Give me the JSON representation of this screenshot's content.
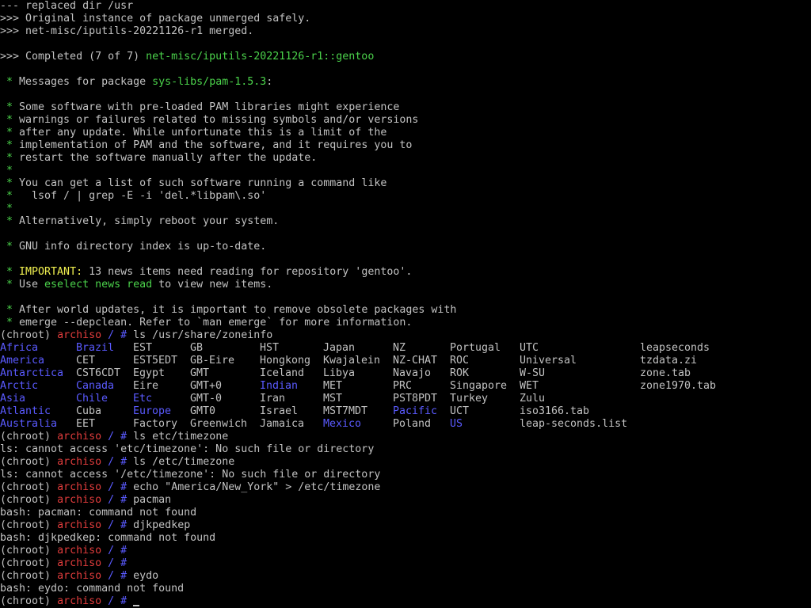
{
  "terminal": {
    "colors": {
      "background": "#000000",
      "text": "#c2c2c2",
      "green": "#4bd24b",
      "yellow": "#f0f050",
      "red": "#e03c3c",
      "blue": "#5a5aff"
    },
    "prompt": {
      "chroot": "(chroot) ",
      "host": "archiso",
      "sep": " / ",
      "hash": "# "
    },
    "emerge": {
      "replaced": "--- replaced dir /usr",
      "unmerged": ">>> Original instance of package unmerged safely.",
      "merged": ">>> net-misc/iputils-20221126-r1 merged.",
      "completed_prefix": ">>> Completed (7 of 7) ",
      "completed_pkg": "net-misc/iputils-20221126-r1::gentoo"
    },
    "messages": {
      "header_prefix": " Messages for package ",
      "header_pkg": "sys-libs/pam-1.5.3",
      "header_suffix": ":",
      "star": " *",
      "l1": " Some software with pre-loaded PAM libraries might experience",
      "l2": " warnings or failures related to missing symbols and/or versions",
      "l3": " after any update. While unfortunate this is a limit of the",
      "l4": " implementation of PAM and the software, and it requires you to",
      "l5": " restart the software manually after the update.",
      "l6": " You can get a list of such software running a command like",
      "l7": "   lsof / | grep -E -i 'del.*libpam\\.so'",
      "l8": " Alternatively, simply reboot your system.",
      "l9": " GNU info directory index is up-to-date.",
      "important_label": " IMPORTANT:",
      "important_text": " 13 news items need reading for repository 'gentoo'.",
      "use_prefix": " Use ",
      "use_cmd": "eselect news read",
      "use_suffix": " to view new items.",
      "l10": " After world updates, it is important to remove obsolete packages with",
      "l11": " emerge --depclean. Refer to `man emerge` for more information."
    },
    "commands": {
      "ls_zoneinfo": "ls /usr/share/zoneinfo",
      "ls_etc": "ls etc/timezone",
      "ls_etc_err": "ls: cannot access 'etc/timezone': No such file or directory",
      "ls_abs": "ls /etc/timezone",
      "ls_abs_err": "ls: cannot access '/etc/timezone': No such file or directory",
      "echo": "echo \"America/New_York\" > /etc/timezone",
      "pacman": "pacman",
      "pacman_err": "bash: pacman: command not found",
      "djk": "djkpedkep",
      "djk_err": "bash: djkpedkep: command not found",
      "eydo": "eydo",
      "eydo_err": "bash: eydo: command not found"
    },
    "zoneinfo_rows": [
      [
        {
          "t": "Africa",
          "c": "b"
        },
        {
          "t": "Brazil",
          "c": "b"
        },
        {
          "t": "EST",
          "c": ""
        },
        {
          "t": "GB",
          "c": ""
        },
        {
          "t": "HST",
          "c": ""
        },
        {
          "t": "Japan",
          "c": ""
        },
        {
          "t": "NZ",
          "c": ""
        },
        {
          "t": "Portugal",
          "c": ""
        },
        {
          "t": "UTC",
          "c": ""
        },
        {
          "t": "leapseconds",
          "c": ""
        }
      ],
      [
        {
          "t": "America",
          "c": "b"
        },
        {
          "t": "CET",
          "c": ""
        },
        {
          "t": "EST5EDT",
          "c": ""
        },
        {
          "t": "GB-Eire",
          "c": ""
        },
        {
          "t": "Hongkong",
          "c": ""
        },
        {
          "t": "Kwajalein",
          "c": ""
        },
        {
          "t": "NZ-CHAT",
          "c": ""
        },
        {
          "t": "ROC",
          "c": ""
        },
        {
          "t": "Universal",
          "c": ""
        },
        {
          "t": "tzdata.zi",
          "c": ""
        }
      ],
      [
        {
          "t": "Antarctica",
          "c": "b"
        },
        {
          "t": "CST6CDT",
          "c": ""
        },
        {
          "t": "Egypt",
          "c": ""
        },
        {
          "t": "GMT",
          "c": ""
        },
        {
          "t": "Iceland",
          "c": ""
        },
        {
          "t": "Libya",
          "c": ""
        },
        {
          "t": "Navajo",
          "c": ""
        },
        {
          "t": "ROK",
          "c": ""
        },
        {
          "t": "W-SU",
          "c": ""
        },
        {
          "t": "zone.tab",
          "c": ""
        }
      ],
      [
        {
          "t": "Arctic",
          "c": "b"
        },
        {
          "t": "Canada",
          "c": "b"
        },
        {
          "t": "Eire",
          "c": ""
        },
        {
          "t": "GMT+0",
          "c": ""
        },
        {
          "t": "Indian",
          "c": "b"
        },
        {
          "t": "MET",
          "c": ""
        },
        {
          "t": "PRC",
          "c": ""
        },
        {
          "t": "Singapore",
          "c": ""
        },
        {
          "t": "WET",
          "c": ""
        },
        {
          "t": "zone1970.tab",
          "c": ""
        }
      ],
      [
        {
          "t": "Asia",
          "c": "b"
        },
        {
          "t": "Chile",
          "c": "b"
        },
        {
          "t": "Etc",
          "c": "b"
        },
        {
          "t": "GMT-0",
          "c": ""
        },
        {
          "t": "Iran",
          "c": ""
        },
        {
          "t": "MST",
          "c": ""
        },
        {
          "t": "PST8PDT",
          "c": ""
        },
        {
          "t": "Turkey",
          "c": ""
        },
        {
          "t": "Zulu",
          "c": ""
        },
        {
          "t": "",
          "c": ""
        }
      ],
      [
        {
          "t": "Atlantic",
          "c": "b"
        },
        {
          "t": "Cuba",
          "c": ""
        },
        {
          "t": "Europe",
          "c": "b"
        },
        {
          "t": "GMT0",
          "c": ""
        },
        {
          "t": "Israel",
          "c": ""
        },
        {
          "t": "MST7MDT",
          "c": ""
        },
        {
          "t": "Pacific",
          "c": "b"
        },
        {
          "t": "UCT",
          "c": ""
        },
        {
          "t": "iso3166.tab",
          "c": ""
        },
        {
          "t": "",
          "c": ""
        }
      ],
      [
        {
          "t": "Australia",
          "c": "b"
        },
        {
          "t": "EET",
          "c": ""
        },
        {
          "t": "Factory",
          "c": ""
        },
        {
          "t": "Greenwich",
          "c": ""
        },
        {
          "t": "Jamaica",
          "c": ""
        },
        {
          "t": "Mexico",
          "c": "b"
        },
        {
          "t": "Poland",
          "c": ""
        },
        {
          "t": "US",
          "c": "b"
        },
        {
          "t": "leap-seconds.list",
          "c": ""
        },
        {
          "t": "",
          "c": ""
        }
      ]
    ]
  }
}
